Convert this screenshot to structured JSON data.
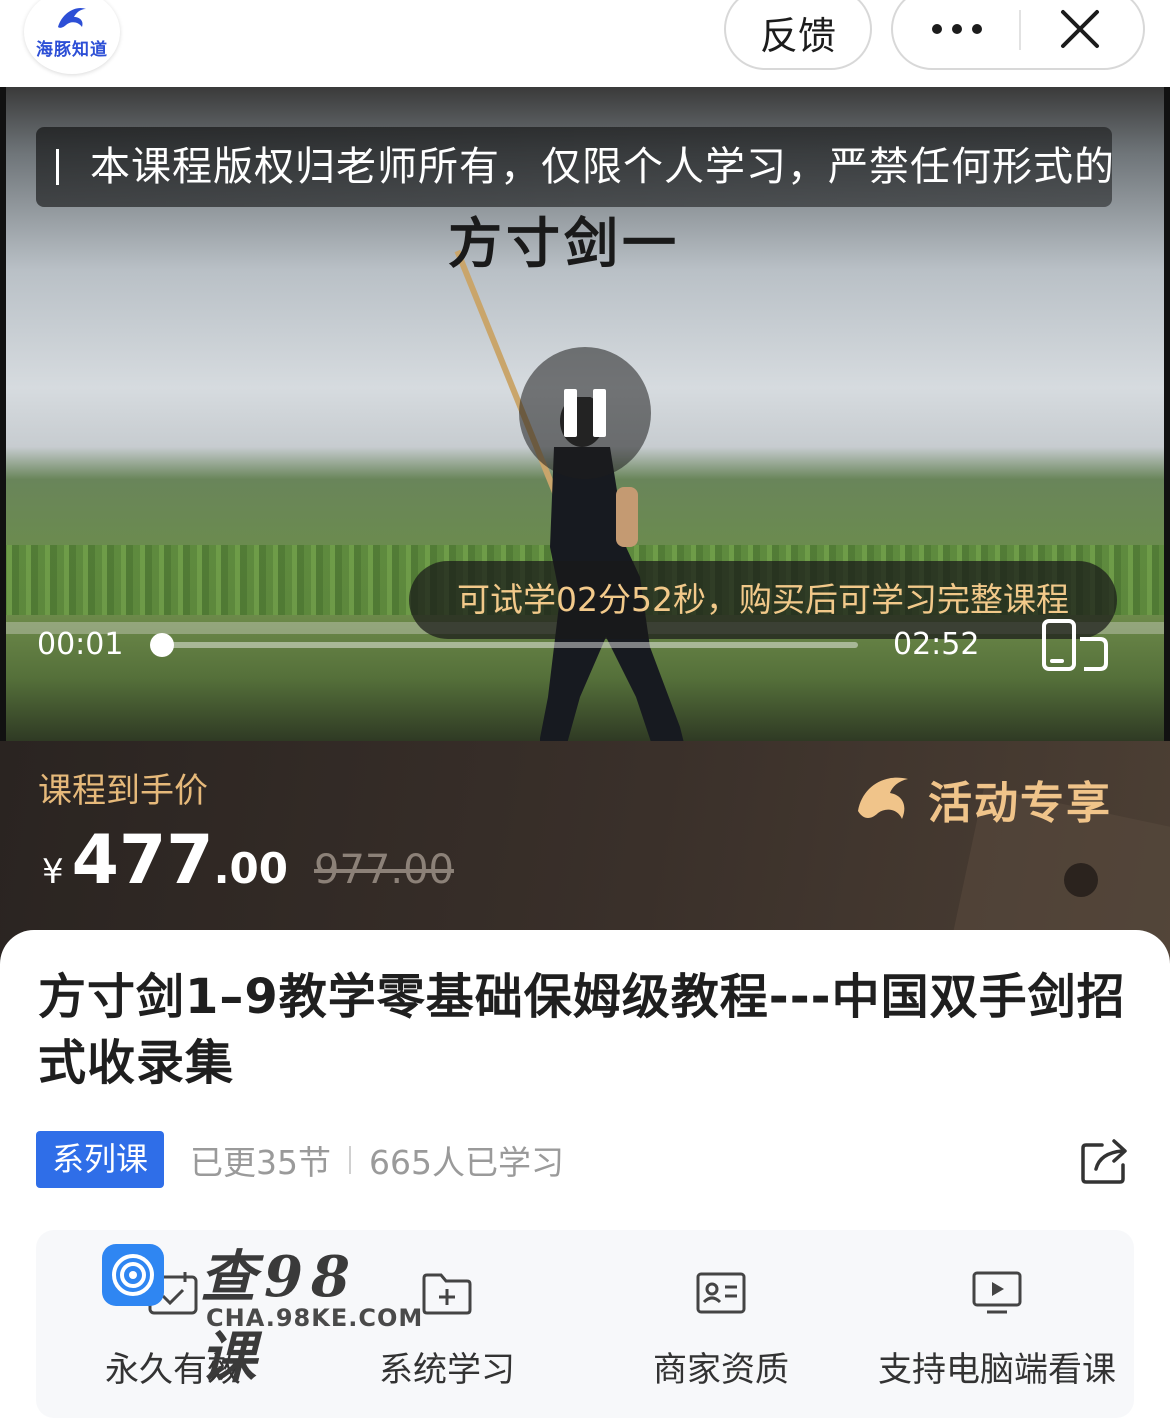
{
  "topbar": {
    "logo_text": "海豚知道",
    "feedback_label": "反馈",
    "more_label": "•••"
  },
  "video": {
    "copyright_notice": "本课程版权归老师所有，仅限个人学习，严禁任何形式的",
    "overlay_title": "方寸剑一",
    "trial_tip": "可试学02分52秒，购买后可学习完整课程",
    "current_time": "00:01",
    "duration": "02:52",
    "progress_fraction": 0.006
  },
  "price": {
    "label": "课程到手价",
    "currency": "¥",
    "integer": "477",
    "decimal": ".00",
    "original": "977.00",
    "activity_label": "活动专享",
    "accent_color": "#e6b97a"
  },
  "course": {
    "title": "方寸剑1–9教学零基础保姆级教程---中国双手剑招式收录集",
    "tag": "系列课",
    "updated": "已更35节",
    "learners": "665人已学习",
    "tag_color": "#2f6ee8"
  },
  "features": [
    {
      "label": "永久有效",
      "icon": "calendar-check-icon"
    },
    {
      "label": "系统学习",
      "icon": "folder-plus-icon"
    },
    {
      "label": "商家资质",
      "icon": "id-card-icon"
    },
    {
      "label": "支持电脑端看课",
      "icon": "monitor-play-icon"
    }
  ],
  "watermark": {
    "big": "查98课",
    "small": "CHA.98KE.COM"
  }
}
